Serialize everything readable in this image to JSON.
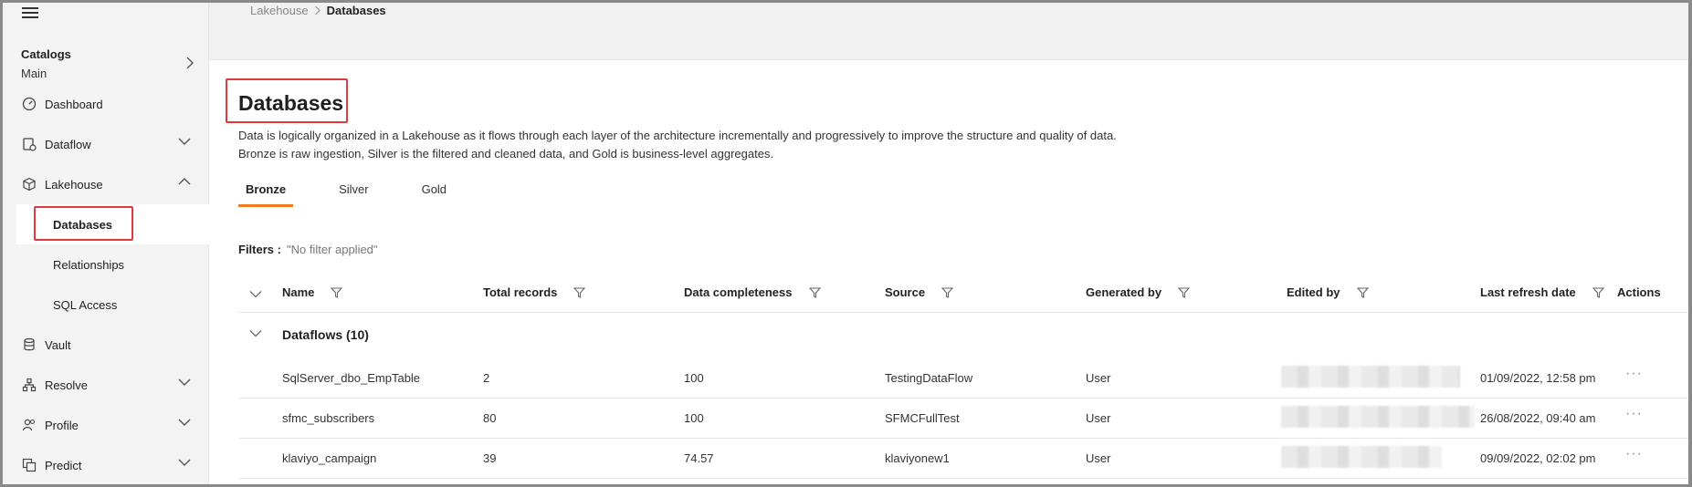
{
  "sidebar": {
    "catalog_title": "Catalogs",
    "catalog_name": "Main",
    "items": [
      {
        "label": "Dashboard",
        "icon": "dashboard-icon"
      },
      {
        "label": "Dataflow",
        "icon": "dataflow-icon"
      },
      {
        "label": "Lakehouse",
        "icon": "cube-icon"
      },
      {
        "label": "Vault",
        "icon": "database-icon"
      },
      {
        "label": "Resolve",
        "icon": "hierarchy-icon"
      },
      {
        "label": "Profile",
        "icon": "people-icon"
      },
      {
        "label": "Predict",
        "icon": "predict-icon"
      }
    ],
    "sub_items": [
      {
        "label": "Databases"
      },
      {
        "label": "Relationships"
      },
      {
        "label": "SQL Access"
      }
    ]
  },
  "breadcrumb": {
    "parent": "Lakehouse",
    "current": "Databases"
  },
  "page": {
    "title": "Databases",
    "desc_line1": "Data is logically organized in a Lakehouse as it flows through each layer of the architecture incrementally and progressively to improve the structure and quality of data.",
    "desc_line2": "Bronze is raw ingestion, Silver is the filtered and cleaned data, and Gold is business-level aggregates."
  },
  "tabs": [
    {
      "label": "Bronze",
      "active": true
    },
    {
      "label": "Silver"
    },
    {
      "label": "Gold"
    }
  ],
  "filters": {
    "label": "Filters :",
    "value": "\"No filter applied\""
  },
  "table": {
    "columns": {
      "name": "Name",
      "total_records": "Total records",
      "completeness": "Data completeness",
      "source": "Source",
      "generated_by": "Generated by",
      "edited_by": "Edited by",
      "last_refresh": "Last refresh date",
      "actions": "Actions"
    },
    "group_label": "Dataflows (10)",
    "rows": [
      {
        "name": "SqlServer_dbo_EmpTable",
        "total": "2",
        "completeness": "100",
        "source": "TestingDataFlow",
        "generated_by": "User",
        "last_refresh": "01/09/2022, 12:58 pm"
      },
      {
        "name": "sfmc_subscribers",
        "total": "80",
        "completeness": "100",
        "source": "SFMCFullTest",
        "generated_by": "User",
        "last_refresh": "26/08/2022, 09:40 am"
      },
      {
        "name": "klaviyo_campaign",
        "total": "39",
        "completeness": "74.57",
        "source": "klaviyonew1",
        "generated_by": "User",
        "last_refresh": "09/09/2022, 02:02 pm"
      }
    ],
    "actions_glyph": "···"
  },
  "colors": {
    "accent": "#f07b21",
    "highlight": "#e0393e"
  }
}
